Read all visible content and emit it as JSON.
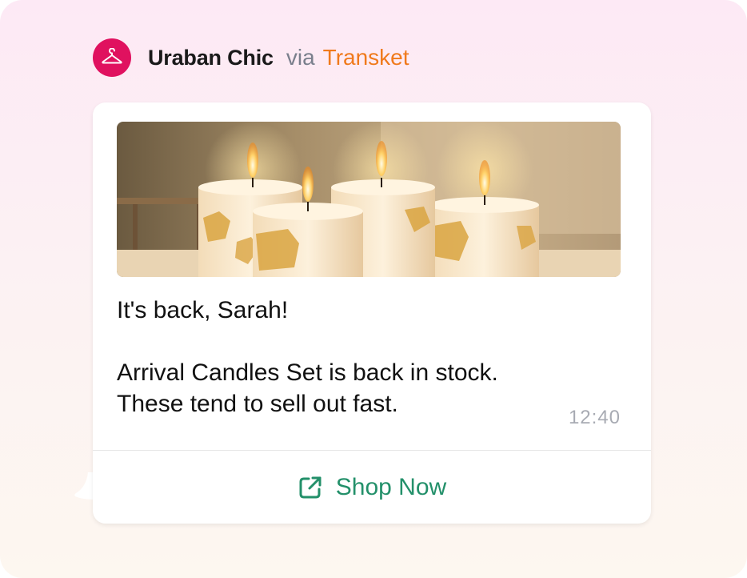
{
  "sender": {
    "name": "Uraban Chic",
    "via_label": "via",
    "provider": "Transket",
    "avatar_icon": "hanger-icon",
    "avatar_color": "#e0115f",
    "provider_color": "#f07a1c"
  },
  "message": {
    "image_icon": "candles-image",
    "greeting": "It's back, Sarah!",
    "body_line1": "Arrival Candles Set is back in stock.",
    "body_line2": "These tend to sell out fast.",
    "time": "12:40"
  },
  "cta": {
    "label": "Shop Now",
    "icon": "external-link-icon",
    "color": "#23906a"
  }
}
